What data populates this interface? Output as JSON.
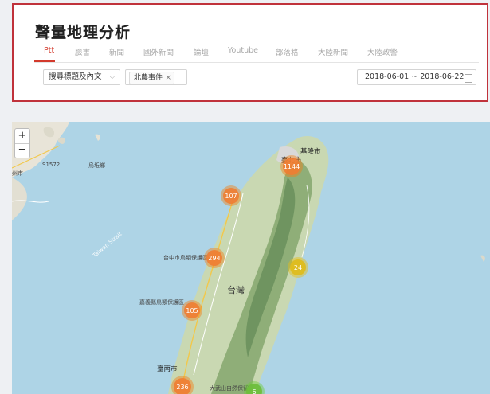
{
  "page_title": "聲量地理分析",
  "tabs": [
    {
      "label": "Ptt",
      "active": true
    },
    {
      "label": "臉書",
      "active": false
    },
    {
      "label": "新聞",
      "active": false
    },
    {
      "label": "國外新聞",
      "active": false
    },
    {
      "label": "論壇",
      "active": false
    },
    {
      "label": "Youtube",
      "active": false
    },
    {
      "label": "部落格",
      "active": false
    },
    {
      "label": "大陸新聞",
      "active": false
    },
    {
      "label": "大陸政警",
      "active": false
    }
  ],
  "filters": {
    "search_field": "搜尋標題及內文",
    "keyword_tag": "北農事件",
    "keyword_tag_remove": "×",
    "date_range": "2018-06-01 ~ 2018-06-22"
  },
  "map": {
    "zoom_in": "+",
    "zoom_out": "−",
    "labels": {
      "left_city": "州市",
      "road": "S1572",
      "town": "烏坵鄉",
      "keelung": "基隆市",
      "taipei": "臺北市",
      "strait": "Taiwan Strait",
      "taiwan": "台灣",
      "tainan": "臺南市",
      "reserve1": "台中市鳥類保護區",
      "reserve2": "嘉義縣鳥類保護區",
      "reserve3": "大武山自然保留區"
    },
    "clusters": [
      {
        "count": "1144",
        "color": "orange"
      },
      {
        "count": "107",
        "color": "orange"
      },
      {
        "count": "294",
        "color": "orange"
      },
      {
        "count": "24",
        "color": "yellow"
      },
      {
        "count": "105",
        "color": "orange"
      },
      {
        "count": "236",
        "color": "orange"
      },
      {
        "count": "6",
        "color": "green"
      }
    ]
  },
  "colors": {
    "accent": "#d33a2c",
    "highlight_border": "#c0323b",
    "sea": "#aed4e6"
  }
}
